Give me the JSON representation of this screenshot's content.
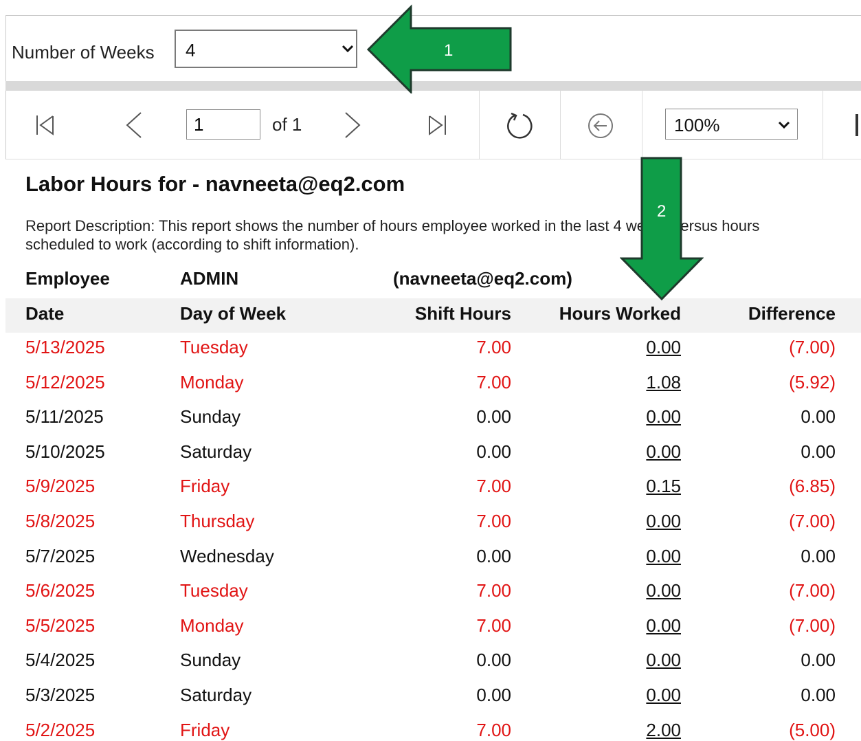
{
  "parameters": {
    "label": "Number of Weeks",
    "value": "4"
  },
  "toolbar": {
    "page_value": "1",
    "of_text": "of 1",
    "zoom": "100%"
  },
  "report": {
    "title": "Labor Hours for - navneeta@eq2.com",
    "description_line1": "Report Description: This report shows the number of hours employee worked in the last 4 weeks versus hours",
    "description_line2": "scheduled to work (according to shift information).",
    "employee_label": "Employee",
    "employee_name": "ADMIN",
    "employee_email": "(navneeta@eq2.com)",
    "columns": [
      "Date",
      "Day of Week",
      "Shift Hours",
      "Hours Worked",
      "Difference"
    ],
    "rows": [
      {
        "date": "5/13/2025",
        "day": "Tuesday",
        "shift": "7.00",
        "worked": "0.00",
        "diff": "(7.00)",
        "highlight": true
      },
      {
        "date": "5/12/2025",
        "day": "Monday",
        "shift": "7.00",
        "worked": "1.08",
        "diff": "(5.92)",
        "highlight": true
      },
      {
        "date": "5/11/2025",
        "day": "Sunday",
        "shift": "0.00",
        "worked": "0.00",
        "diff": "0.00",
        "highlight": false
      },
      {
        "date": "5/10/2025",
        "day": "Saturday",
        "shift": "0.00",
        "worked": "0.00",
        "diff": "0.00",
        "highlight": false
      },
      {
        "date": "5/9/2025",
        "day": "Friday",
        "shift": "7.00",
        "worked": "0.15",
        "diff": "(6.85)",
        "highlight": true
      },
      {
        "date": "5/8/2025",
        "day": "Thursday",
        "shift": "7.00",
        "worked": "0.00",
        "diff": "(7.00)",
        "highlight": true
      },
      {
        "date": "5/7/2025",
        "day": "Wednesday",
        "shift": "0.00",
        "worked": "0.00",
        "diff": "0.00",
        "highlight": false
      },
      {
        "date": "5/6/2025",
        "day": "Tuesday",
        "shift": "7.00",
        "worked": "0.00",
        "diff": "(7.00)",
        "highlight": true
      },
      {
        "date": "5/5/2025",
        "day": "Monday",
        "shift": "7.00",
        "worked": "0.00",
        "diff": "(7.00)",
        "highlight": true
      },
      {
        "date": "5/4/2025",
        "day": "Sunday",
        "shift": "0.00",
        "worked": "0.00",
        "diff": "0.00",
        "highlight": false
      },
      {
        "date": "5/3/2025",
        "day": "Saturday",
        "shift": "0.00",
        "worked": "0.00",
        "diff": "0.00",
        "highlight": false
      },
      {
        "date": "5/2/2025",
        "day": "Friday",
        "shift": "7.00",
        "worked": "2.00",
        "diff": "(5.00)",
        "highlight": true
      }
    ]
  },
  "annotations": {
    "arrow1": "1",
    "arrow2": "2"
  },
  "colors": {
    "negative_text": "#e11414",
    "arrow_fill": "#0f9d48",
    "arrow_stroke": "#1e3a2c"
  },
  "icons": [
    "first-page-icon",
    "previous-page-icon",
    "next-page-icon",
    "last-page-icon",
    "refresh-icon",
    "back-icon",
    "chevron-down-icon"
  ]
}
